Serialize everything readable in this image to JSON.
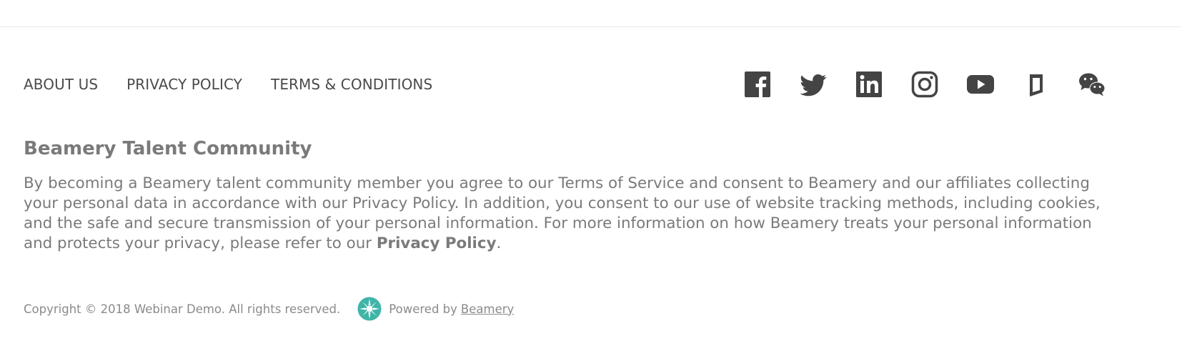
{
  "nav": {
    "about": "ABOUT US",
    "privacy": "PRIVACY POLICY",
    "terms": "TERMS & CONDITIONS"
  },
  "social": {
    "icons": [
      "facebook-icon",
      "twitter-icon",
      "linkedin-icon",
      "instagram-icon",
      "youtube-icon",
      "glassdoor-icon",
      "wechat-icon"
    ],
    "color": "#444444"
  },
  "community": {
    "title": "Beamery Talent Community",
    "text_before_link": "By becoming a Beamery talent community member you agree to our Terms of Service and consent to Beamery and our affiliates collecting your personal data in accordance with our Privacy Policy. In addition, you consent to our use of website tracking methods, including cookies, and the safe and secure transmission of your personal information. For more information on how Beamery treats your personal information and protects your privacy, please refer to our ",
    "link_label": "Privacy Policy",
    "text_after_link": "."
  },
  "footer": {
    "copyright": "Copyright © 2018 Webinar Demo. All rights reserved.",
    "powered_by": "Powered by",
    "powered_link": "Beamery",
    "logo_color": "#3fb5a8"
  }
}
